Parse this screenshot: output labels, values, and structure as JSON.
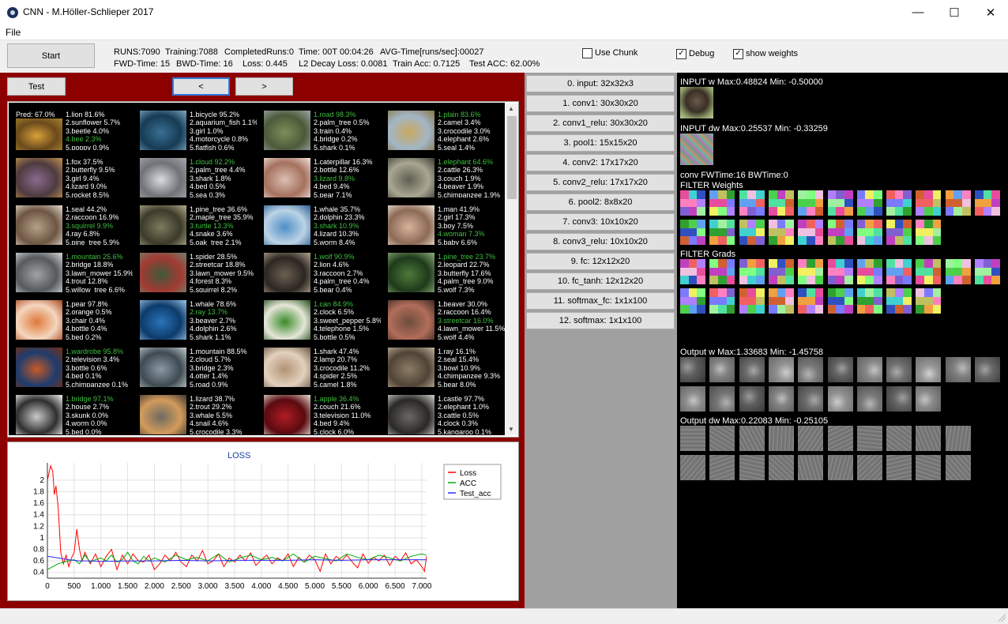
{
  "window": {
    "title": "CNN - M.Höller-Schlieper 2017",
    "minimize": "—",
    "maximize": "☐",
    "close": "✕"
  },
  "menu": {
    "file": "File"
  },
  "toolbar": {
    "start": "Start",
    "row1": {
      "runs": "RUNS:7090",
      "training": "Training:7088",
      "completed": "CompletedRuns:0",
      "time": "Time: 00T 00:04:26",
      "avg": "AVG-Time[runs/sec]:00027"
    },
    "row2": {
      "fwd": "FWD-Time:  15",
      "bwd": "BWD-Time:  16",
      "loss": "Loss: 0.445",
      "l2": "L2 Decay Loss: 0.0081",
      "train_acc": "Train Acc: 0.7125",
      "test_acc": "Test ACC: 62.00%"
    },
    "use_chunk": {
      "label": "Use Chunk",
      "checked": false
    },
    "debug": {
      "label": "Debug",
      "checked": true
    },
    "show_weights": {
      "label": "show weights",
      "checked": true
    }
  },
  "left": {
    "test": "Test",
    "prev": "<",
    "next": ">",
    "pred_label": "Pred: 67.0%"
  },
  "cells": [
    {
      "lines": [
        "1.lion 81.6%",
        "2.sunflower 5.7%",
        "3.beetle 4.0%",
        "4.bee 2.3%",
        "5.poppy 0.9%"
      ],
      "hit": 3,
      "img": [
        "#d8a23a",
        "#6b4a1c",
        "#a7832c"
      ]
    },
    {
      "lines": [
        "1.bicycle 95.2%",
        "2.aquarium_fish 1.1%",
        "3.girl 1.0%",
        "4.motorcycle 0.8%",
        "5.flatfish 0.6%"
      ],
      "hit": -1,
      "img": [
        "#3a6f93",
        "#163b54",
        "#7fa9c2"
      ]
    },
    {
      "lines": [
        "1.road 98.3%",
        "2.palm_tree 0.5%",
        "3.train 0.4%",
        "4.bridge 0.2%",
        "5.shark 0.1%"
      ],
      "hit": 0,
      "img": [
        "#7d8f5a",
        "#4c5a3a",
        "#9aa7a5"
      ]
    },
    {
      "lines": [
        "1.plain 83.6%",
        "2.camel 3.4%",
        "3.crocodile 3.0%",
        "4.elephant 2.6%",
        "5.seal 1.4%"
      ],
      "hit": 0,
      "img": [
        "#c9a85f",
        "#a2b6c6",
        "#8a7442"
      ]
    },
    {
      "lines": [
        "1.fox 37.5%",
        "2.butterfly 9.5%",
        "3.girl 9.4%",
        "4.lizard 9.0%",
        "5.rocket 8.5%"
      ],
      "hit": -1,
      "img": [
        "#8a6a8e",
        "#4d3b3f",
        "#c4924f"
      ]
    },
    {
      "lines": [
        "1.cloud 92.2%",
        "2.palm_tree 4.4%",
        "3.shark 1.8%",
        "4.bed 0.5%",
        "5.sea 0.3%"
      ],
      "hit": 0,
      "img": [
        "#d9dde2",
        "#6f7277",
        "#a5a9ad"
      ]
    },
    {
      "lines": [
        "1.caterpillar 16.3%",
        "2.bottle 12.6%",
        "3.lizard 9.8%",
        "4.bed 9.4%",
        "5.pear 7.1%"
      ],
      "hit": 2,
      "img": [
        "#d9bfb2",
        "#a6705e",
        "#efe3db"
      ]
    },
    {
      "lines": [
        "1.elephant 64.6%",
        "2.cattle 26.3%",
        "3.couch 1.9%",
        "4.beaver 1.9%",
        "5.chimpanzee 1.9%"
      ],
      "hit": 0,
      "img": [
        "#5f6052",
        "#a9a691",
        "#3a3a33"
      ]
    },
    {
      "lines": [
        "1.seal 44.2%",
        "2.raccoon 16.9%",
        "3.squirrel 9.9%",
        "4.ray 6.8%",
        "5.pine_tree 5.9%"
      ],
      "hit": 2,
      "img": [
        "#b4a089",
        "#6d5642",
        "#e4dbcf"
      ]
    },
    {
      "lines": [
        "1.pine_tree 36.6%",
        "2.maple_tree 35.9%",
        "3.turtle 13.3%",
        "4.snake 3.6%",
        "5.oak_tree 2.1%"
      ],
      "hit": 2,
      "img": [
        "#7d7a5e",
        "#3c3a2a",
        "#b2ad8c"
      ]
    },
    {
      "lines": [
        "1.whale 35.7%",
        "2.dolphin 23.3%",
        "3.shark 10.9%",
        "4.lizard 10.3%",
        "5.worm 8.4%"
      ],
      "hit": 2,
      "img": [
        "#4f8fc6",
        "#bcd3e6",
        "#2b5f92"
      ]
    },
    {
      "lines": [
        "1.man 41.9%",
        "2.girl 17.3%",
        "3.boy 7.5%",
        "4.woman 7.3%",
        "5.baby 6.6%"
      ],
      "hit": 3,
      "img": [
        "#d6b49c",
        "#8c6a55",
        "#f1e4d6"
      ]
    },
    {
      "lines": [
        "1.mountain 25.6%",
        "2.bridge 18.8%",
        "3.lawn_mower 15.9%",
        "4.trout 12.8%",
        "5.willow_tree 6.6%"
      ],
      "hit": 0,
      "img": [
        "#9fa3a6",
        "#565a5d",
        "#d7d9db"
      ]
    },
    {
      "lines": [
        "1.spider 28.5%",
        "2.streetcar 18.8%",
        "3.lawn_mower 9.5%",
        "4.forest 8.3%",
        "5.squirrel 8.2%"
      ],
      "hit": -1,
      "img": [
        "#3e5a3a",
        "#a13a33",
        "#72806a"
      ]
    },
    {
      "lines": [
        "1.wolf 90.9%",
        "2.lion 4.6%",
        "3.raccoon 2.7%",
        "4.palm_tree 0.4%",
        "5.bear 0.4%"
      ],
      "hit": 0,
      "img": [
        "#6c6052",
        "#2c2622",
        "#b2a48e"
      ]
    },
    {
      "lines": [
        "1.pine_tree 23.7%",
        "2.leopard 22.7%",
        "3.butterfly 17.6%",
        "4.palm_tree 9.0%",
        "5.wolf 7.3%"
      ],
      "hit": 0,
      "img": [
        "#4d7a3a",
        "#1f3a1b",
        "#8fb07a"
      ]
    },
    {
      "lines": [
        "1.pear 97.8%",
        "2.orange 0.5%",
        "3.chair 0.4%",
        "4.bottle 0.4%",
        "5.bed 0.2%"
      ],
      "hit": -1,
      "img": [
        "#e0793a",
        "#f4d6bf",
        "#a8461c"
      ]
    },
    {
      "lines": [
        "1.whale 78.6%",
        "2.ray 13.7%",
        "3.beaver 2.7%",
        "4.dolphin 2.6%",
        "5.shark 1.1%"
      ],
      "hit": 1,
      "img": [
        "#2b73b8",
        "#0d3b6b",
        "#9bc6e8"
      ]
    },
    {
      "lines": [
        "1.can 84.9%",
        "2.clock 6.5%",
        "3.sweet_pepper 5.8%",
        "4.telephone 1.5%",
        "5.bottle 0.5%"
      ],
      "hit": 0,
      "img": [
        "#3a8a2a",
        "#e6e6d8",
        "#1d4d15"
      ]
    },
    {
      "lines": [
        "1.beaver 30.0%",
        "2.raccoon 16.4%",
        "3.streetcar 16.0%",
        "4.lawn_mower 11.5%",
        "5.wolf 4.4%"
      ],
      "hit": 2,
      "img": [
        "#6d4d3c",
        "#b26d5a",
        "#3a2a22"
      ]
    },
    {
      "lines": [
        "1.wardrobe 95.8%",
        "2.television 3.4%",
        "3.bottle 0.6%",
        "4.bed 0.1%",
        "5.chimpanzee 0.1%"
      ],
      "hit": 0,
      "img": [
        "#c65a26",
        "#1d3c6e",
        "#7a2f12"
      ]
    },
    {
      "lines": [
        "1.mountain 88.5%",
        "2.cloud 5.7%",
        "3.bridge 2.3%",
        "4.otter 1.4%",
        "5.road 0.9%"
      ],
      "hit": -1,
      "img": [
        "#8a9aa5",
        "#3f4a52",
        "#c3ccd2"
      ]
    },
    {
      "lines": [
        "1.shark 47.4%",
        "2.lamp 20.7%",
        "3.crocodile 11.2%",
        "4.spider 2.5%",
        "5.camel 1.8%"
      ],
      "hit": -1,
      "img": [
        "#b29274",
        "#e2d1bd",
        "#6d5744"
      ]
    },
    {
      "lines": [
        "1.ray 16.1%",
        "2.seal 15.4%",
        "3.bowl 10.9%",
        "4.chimpanzee 9.3%",
        "5.bear 8.0%"
      ],
      "hit": -1,
      "img": [
        "#8d7b65",
        "#4f4437",
        "#c3b29a"
      ]
    },
    {
      "lines": [
        "1.bridge 97.1%",
        "2.house 2.7%",
        "3.skunk 0.0%",
        "4.worm 0.0%",
        "5.bed 0.0%"
      ],
      "hit": 0,
      "img": [
        "#c9c9c9",
        "#2f2f2f",
        "#f2f2f2"
      ]
    },
    {
      "lines": [
        "1.lizard 38.7%",
        "2.trout 29.2%",
        "3.whale 5.5%",
        "4.snail 4.6%",
        "5.crocodile 3.3%"
      ],
      "hit": -1,
      "img": [
        "#6e6a62",
        "#d39b5c",
        "#39362f"
      ]
    },
    {
      "lines": [
        "1.apple 36.4%",
        "2.couch 21.6%",
        "3.television 11.0%",
        "4.bed 9.4%",
        "5.clock 6.0%"
      ],
      "hit": 0,
      "img": [
        "#b01c24",
        "#5a0a10",
        "#e9e2d6"
      ]
    },
    {
      "lines": [
        "1.castle 97.7%",
        "2.elephant 1.0%",
        "3.cattle 0.5%",
        "4.clock 0.3%",
        "5.kangaroo 0.1%"
      ],
      "hit": -1,
      "img": [
        "#6a6864",
        "#2a2927",
        "#d5d2cb"
      ]
    }
  ],
  "chart_data": {
    "type": "line",
    "title": "LOSS",
    "xlim": [
      0,
      7090
    ],
    "ylim": [
      0.3,
      2.3
    ],
    "x_ticks": [
      "0",
      "500",
      "1.000",
      "1.500",
      "2.000",
      "2.500",
      "3.000",
      "3.500",
      "4.000",
      "4.500",
      "5.000",
      "5.500",
      "6.000",
      "6.500",
      "7.000"
    ],
    "y_ticks": [
      "0.4",
      "0.6",
      "0.8",
      "1",
      "1.2",
      "1.4",
      "1.6",
      "1.8",
      "2"
    ],
    "grid": true,
    "legend": "top-right",
    "series": [
      {
        "name": "Loss",
        "color": "#ff0000",
        "x": [
          0,
          60,
          100,
          130,
          160,
          200,
          250,
          300,
          350,
          400,
          450,
          500,
          550,
          600,
          650,
          700,
          800,
          900,
          1000,
          1100,
          1200,
          1300,
          1400,
          1500,
          1600,
          1700,
          1800,
          1900,
          2000,
          2100,
          2200,
          2300,
          2400,
          2500,
          2600,
          2700,
          2800,
          2900,
          3000,
          3100,
          3200,
          3300,
          3400,
          3500,
          3600,
          3700,
          3800,
          3900,
          4000,
          4100,
          4200,
          4300,
          4400,
          4500,
          4600,
          4700,
          4800,
          4900,
          5000,
          5100,
          5200,
          5300,
          5400,
          5500,
          5600,
          5700,
          5800,
          5900,
          6000,
          6100,
          6200,
          6300,
          6400,
          6500,
          6600,
          6700,
          6800,
          6900,
          7000,
          7050,
          7090
        ],
        "y": [
          2.0,
          2.25,
          2.15,
          1.75,
          1.9,
          1.55,
          0.75,
          0.55,
          0.7,
          0.5,
          0.65,
          0.75,
          1.15,
          0.8,
          0.6,
          0.75,
          0.55,
          0.72,
          0.5,
          0.68,
          0.8,
          0.45,
          0.7,
          0.55,
          0.72,
          0.6,
          0.58,
          0.7,
          0.45,
          0.55,
          0.7,
          0.6,
          0.75,
          0.58,
          0.5,
          0.7,
          0.6,
          0.78,
          0.55,
          0.6,
          0.72,
          0.5,
          0.65,
          0.58,
          0.7,
          0.6,
          0.74,
          0.52,
          0.62,
          0.7,
          0.55,
          0.65,
          0.6,
          0.72,
          0.5,
          0.66,
          0.58,
          0.7,
          0.62,
          0.42,
          0.72,
          0.55,
          0.68,
          0.6,
          0.7,
          0.58,
          0.48,
          0.72,
          0.56,
          0.66,
          0.6,
          0.7,
          0.52,
          0.68,
          0.6,
          0.74,
          0.55,
          0.62,
          0.5,
          0.42,
          0.68
        ]
      },
      {
        "name": "ACC",
        "color": "#00aa00",
        "x": [
          0,
          100,
          200,
          300,
          400,
          500,
          600,
          700,
          800,
          900,
          1000,
          1100,
          1200,
          1300,
          1400,
          1500,
          1600,
          1700,
          1800,
          1900,
          2000,
          2200,
          2400,
          2600,
          2800,
          3000,
          3200,
          3400,
          3600,
          3800,
          4000,
          4200,
          4400,
          4600,
          4800,
          5000,
          5200,
          5400,
          5600,
          5800,
          6000,
          6200,
          6400,
          6600,
          6800,
          7000,
          7090
        ],
        "y": [
          0.45,
          0.5,
          0.55,
          0.58,
          0.6,
          0.62,
          0.55,
          0.7,
          0.58,
          0.62,
          0.65,
          0.6,
          0.7,
          0.58,
          0.62,
          0.75,
          0.6,
          0.55,
          0.68,
          0.6,
          0.65,
          0.58,
          0.7,
          0.62,
          0.66,
          0.6,
          0.72,
          0.58,
          0.65,
          0.7,
          0.62,
          0.66,
          0.6,
          0.72,
          0.58,
          0.68,
          0.64,
          0.6,
          0.72,
          0.66,
          0.62,
          0.7,
          0.65,
          0.6,
          0.68,
          0.72,
          0.7
        ]
      },
      {
        "name": "Test_acc",
        "color": "#2a2aff",
        "x": [
          0,
          200,
          400,
          600,
          800,
          1000,
          1500,
          2000,
          2500,
          3000,
          3500,
          4000,
          4500,
          5000,
          5500,
          6000,
          6500,
          7000,
          7090
        ],
        "y": [
          0.68,
          0.65,
          0.62,
          0.6,
          0.6,
          0.59,
          0.6,
          0.6,
          0.61,
          0.6,
          0.61,
          0.61,
          0.61,
          0.62,
          0.61,
          0.62,
          0.62,
          0.62,
          0.62
        ]
      }
    ]
  },
  "layers": [
    "0. input: 32x32x3",
    "1. conv1: 30x30x20",
    "2. conv1_relu: 30x30x20",
    "3. pool1: 15x15x20",
    "4. conv2: 17x17x20",
    "5. conv2_relu: 17x17x20",
    "6. pool2: 8x8x20",
    "7. conv3: 10x10x20",
    "8. conv3_relu: 10x10x20",
    "9. fc: 12x12x20",
    "10. fc_tanh: 12x12x20",
    "11. softmax_fc: 1x1x100",
    "12. softmax: 1x1x100"
  ],
  "right": {
    "input_w": "INPUT w   Max:0.48824 Min: -0.50000",
    "input_dw": "INPUT dw   Max:0.25537 Min: -0.33259",
    "conv_time": "conv FWTime:16 BWTime:0",
    "filter_weights": "FILTER Weights",
    "filter_grads": "FILTER Grads",
    "output_w": "Output w   Max:1.33683 Min: -1.45758",
    "output_dw": "Output dw   Max:0.22083 Min: -0.25105"
  }
}
